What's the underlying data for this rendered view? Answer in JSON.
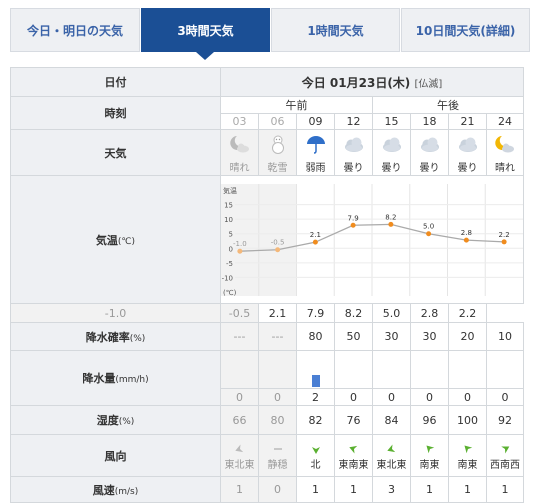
{
  "tabs": [
    {
      "label": "今日・明日の天気",
      "active": false
    },
    {
      "label": "3時間天気",
      "active": true
    },
    {
      "label": "1時間天気",
      "active": false
    },
    {
      "label": "10日間天気(詳細)",
      "active": false
    }
  ],
  "table": {
    "row_labels": {
      "date": "日付",
      "time": "時刻",
      "weather": "天気",
      "temperature": "気温",
      "temperature_unit": "(℃)",
      "precip_prob": "降水確率",
      "precip_prob_unit": "(%)",
      "precip_amount": "降水量",
      "precip_amount_unit": "(mm/h)",
      "humidity": "湿度",
      "humidity_unit": "(%)",
      "wind_dir": "風向",
      "wind_speed": "風速",
      "wind_speed_unit": "(m/s)"
    },
    "date": "今日 01月23日(木)",
    "rokuyo": "[仏滅]",
    "am_label": "午前",
    "pm_label": "午後",
    "hours": [
      "03",
      "06",
      "09",
      "12",
      "15",
      "18",
      "21",
      "24"
    ],
    "weather": [
      "晴れ",
      "乾雪",
      "弱雨",
      "曇り",
      "曇り",
      "曇り",
      "曇り",
      "晴れ"
    ],
    "weather_icons": [
      "moon-cloud-icon",
      "snowman-icon",
      "umbrella-icon",
      "cloud-icon",
      "cloud-icon",
      "cloud-icon",
      "cloud-icon",
      "moon-cloud-icon"
    ],
    "temperature_text": [
      "-1.0",
      "-0.5",
      "2.1",
      "7.9",
      "8.2",
      "5.0",
      "2.8",
      "2.2"
    ],
    "precip_prob": [
      "---",
      "---",
      "80",
      "50",
      "30",
      "30",
      "20",
      "10"
    ],
    "precip_amount": [
      "0",
      "0",
      "2",
      "0",
      "0",
      "0",
      "0",
      "0"
    ],
    "humidity": [
      "66",
      "80",
      "82",
      "76",
      "84",
      "96",
      "100",
      "92"
    ],
    "wind_dir": [
      "東北東",
      "静穏",
      "北",
      "東南東",
      "東北東",
      "南東",
      "南東",
      "西南西"
    ],
    "wind_speed": [
      "1",
      "0",
      "1",
      "1",
      "3",
      "1",
      "1",
      "1"
    ]
  },
  "chart_data": {
    "type": "line",
    "x": [
      "03",
      "06",
      "09",
      "12",
      "15",
      "18",
      "21",
      "24"
    ],
    "series": [
      {
        "values": [
          -1.0,
          -0.5,
          2.1,
          7.9,
          8.2,
          5.0,
          2.8,
          2.2
        ]
      }
    ],
    "ylabel": "気温",
    "unit_top": "気温",
    "unit_bottom": "(℃)",
    "yticks": [
      15,
      10,
      5,
      0,
      -5,
      -10
    ],
    "ylim": [
      -15,
      20
    ],
    "data_labels": [
      "-1.0",
      "-0.5",
      "2.1",
      "7.9",
      "8.2",
      "5.0",
      "2.8",
      "2.2"
    ],
    "line_color": "#aaaaaa",
    "point_color": "#f08c1e"
  },
  "precip_bar_color": "#4a7fd4"
}
